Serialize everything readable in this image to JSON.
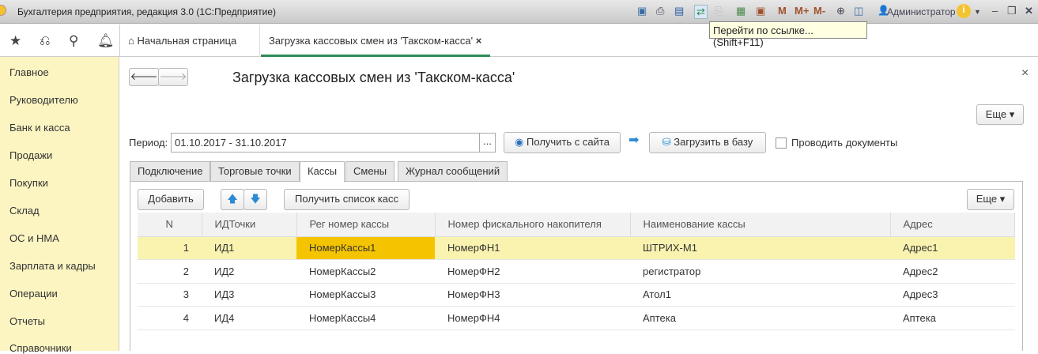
{
  "window": {
    "title": "Бухгалтерия предприятия, редакция 3.0  (1С:Предприятие)",
    "user": "Администратор",
    "tooltip": "Перейти по ссылке... (Shift+F11)",
    "m": "M",
    "mplus": "M+",
    "mminus": "M-"
  },
  "tabs": [
    {
      "label": "Начальная страница"
    },
    {
      "label": "Загрузка кассовых смен из 'Такском-касса'"
    }
  ],
  "sidebar": {
    "items": [
      "Главное",
      "Руководителю",
      "Банк и касса",
      "Продажи",
      "Покупки",
      "Склад",
      "ОС и НМА",
      "Зарплата и кадры",
      "Операции",
      "Отчеты",
      "Справочники"
    ]
  },
  "form": {
    "title": "Загрузка кассовых смен из 'Такском-касса'",
    "more": "Еще",
    "period_label": "Период:",
    "period_value": "01.10.2017 - 31.10.2017",
    "dots": "...",
    "get_from_site": "Получить с сайта",
    "load_to_db": "Загрузить в базу",
    "post_docs": "Проводить документы",
    "post_docs_checked": false,
    "subtabs": [
      "Подключение",
      "Торговые точки",
      "Кассы",
      "Смены",
      "Журнал сообщений"
    ],
    "active_subtab": "Кассы",
    "add": "Добавить",
    "get_list": "Получить список касс",
    "more2": "Еще"
  },
  "table": {
    "columns": [
      "N",
      "ИДТочки",
      "Рег номер кассы",
      "Номер фискального накопителя",
      "Наименование кассы",
      "Адрес"
    ],
    "rows": [
      [
        "1",
        "ИД1",
        "НомерКассы1",
        "НомерФН1",
        "ШТРИХ-М1",
        "Адрес1"
      ],
      [
        "2",
        "ИД2",
        "НомерКассы2",
        "НомерФН2",
        "регистратор",
        "Адрес2"
      ],
      [
        "3",
        "ИД3",
        "НомерКассы3",
        "НомерФН3",
        "Атол1",
        "Адрес3"
      ],
      [
        "4",
        "ИД4",
        "НомерКассы4",
        "НомерФН4",
        "Аптека",
        "Аптека"
      ]
    ]
  }
}
